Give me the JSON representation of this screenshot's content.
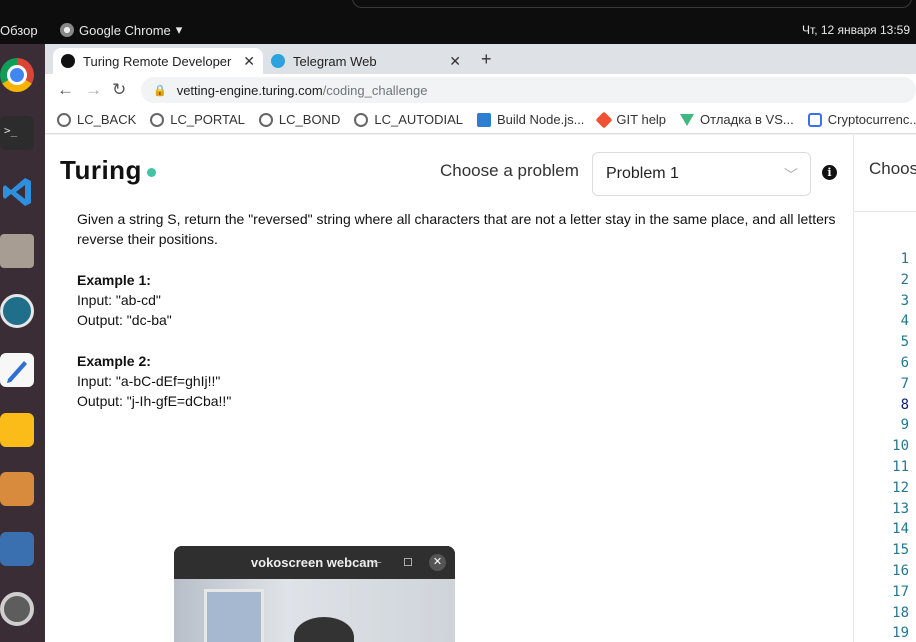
{
  "system": {
    "overview_label": "Обзор",
    "app_menu_label": "Google Chrome",
    "clock": "Чт, 12 января  13:59"
  },
  "tabs": [
    {
      "label": "Turing Remote Developer",
      "close": "✕",
      "icon": "turing-icon",
      "active": true
    },
    {
      "label": "Telegram Web",
      "close": "✕",
      "icon": "telegram-icon",
      "active": false
    }
  ],
  "new_tab": "+",
  "nav": {
    "back": "←",
    "forward": "→",
    "reload": "↻"
  },
  "address": {
    "lock": "🔒",
    "host": "vetting-engine.turing.com",
    "path": "/coding_challenge"
  },
  "bookmarks": [
    {
      "label": "LC_BACK",
      "icon": "globe-icon"
    },
    {
      "label": "LC_PORTAL",
      "icon": "globe-icon"
    },
    {
      "label": "LC_BOND",
      "icon": "globe-icon"
    },
    {
      "label": "LC_AUTODIAL",
      "icon": "globe-icon"
    },
    {
      "label": "Build Node.js...",
      "icon": "vscode-icon"
    },
    {
      "label": "GIT help",
      "icon": "git-icon"
    },
    {
      "label": "Отладка в VS...",
      "icon": "vue-icon"
    },
    {
      "label": "Cryptocurrenc...",
      "icon": "crypto-icon"
    }
  ],
  "header": {
    "logo": "Turing",
    "choose_label": "Choose a problem",
    "selected_problem": "Problem 1",
    "info": "i"
  },
  "problem": {
    "description": "Given a string S, return the \"reversed\" string where all characters that are not a letter stay in the same place, and all letters reverse their positions.",
    "examples": [
      {
        "title": "Example 1:",
        "input": "Input: \"ab-cd\"",
        "output": "Output: \"dc-ba\""
      },
      {
        "title": "Example 2:",
        "input": "Input: \"a-bC-dEf=ghIj!!\"",
        "output": "Output: \"j-Ih-gfE=dCba!!\""
      }
    ]
  },
  "editor": {
    "title": "Choose",
    "line_numbers": [
      "1",
      "2",
      "3",
      "4",
      "5",
      "6",
      "7",
      "8",
      "9",
      "10",
      "11",
      "12",
      "13",
      "14",
      "15",
      "16",
      "17",
      "18",
      "19"
    ],
    "current_line": "8"
  },
  "webcam": {
    "title": "vokoscreen webcam",
    "minimize": "–",
    "close": "✕"
  },
  "dock": [
    "chrome-icon",
    "terminal-icon",
    "vscode-icon",
    "files-icon",
    "remmina-icon",
    "text-editor-icon",
    "calculator-icon",
    "paint-icon",
    "video-editor-icon",
    "settings-icon"
  ],
  "terminal_glyph": ">_"
}
